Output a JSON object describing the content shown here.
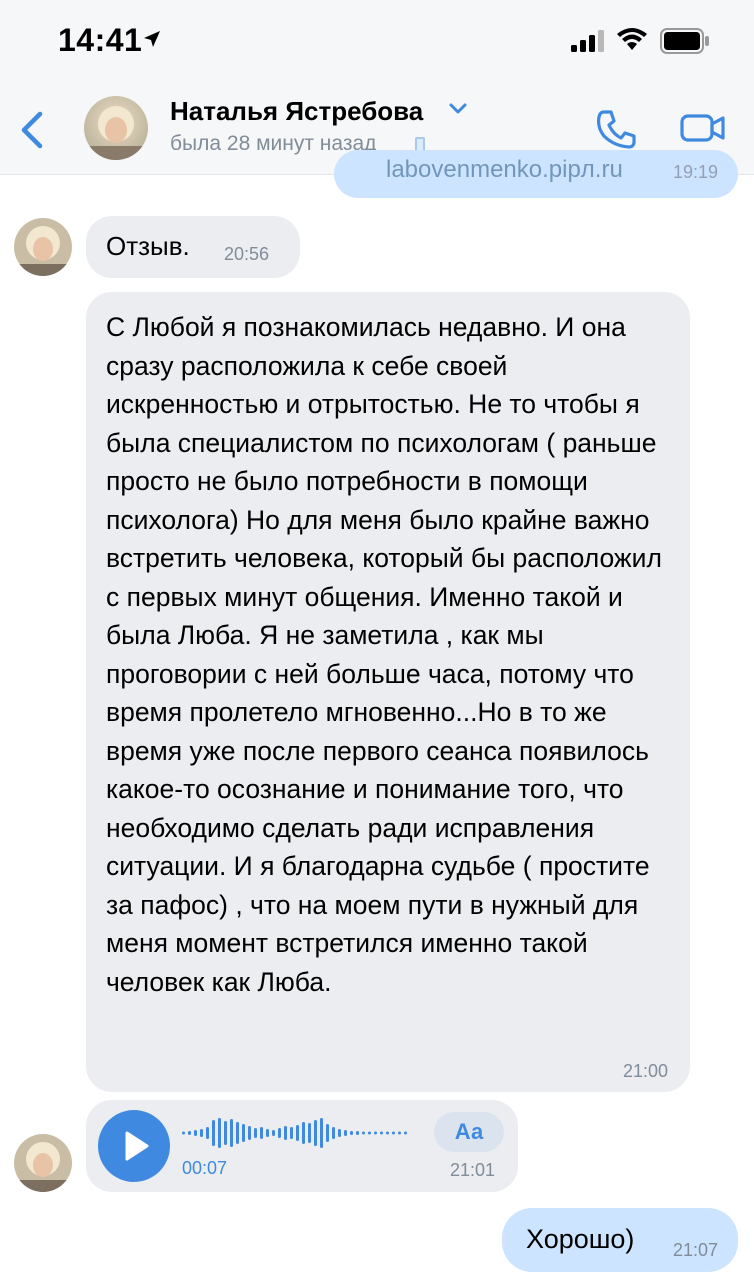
{
  "status_bar": {
    "time": "14:41"
  },
  "header": {
    "contact_name": "Наталья Ястребова",
    "last_seen": "была 28 минут назад"
  },
  "previous_message": {
    "partial_text": "labovenmenko.pipл.ru",
    "time": "19:19"
  },
  "messages": {
    "m1": {
      "text": "Отзыв.",
      "time": "20:56"
    },
    "m2": {
      "text": "С Любой я познакомилась недавно. И она сразу расположила к себе своей искренностью и отрытостью. Не то чтобы я была специалистом по психологам ( раньше просто не было потребности в помощи психолога) Но для меня было крайне важно встретить человека, который бы расположил с первых минут общения. Именно такой и была Люба. Я не заметила , как мы проговории с ней больше часа, потому что время пролетело мгновенно...Но в то же время уже после первого сеанса появилось какое-то осознание и понимание того, что необходимо сделать ради исправления ситуации. И я благодарна судьбе ( простите за пафос) , что на моем пути в нужный для меня момент встретился именно такой человек как Люба.",
      "time": "21:00"
    },
    "voice": {
      "duration": "00:07",
      "transcribe_label": "Аа",
      "time": "21:01"
    },
    "outgoing": {
      "text": "Хорошо)",
      "time": "21:07"
    }
  },
  "colors": {
    "accent": "#3f8ae0",
    "incoming_bubble": "#ebedf0",
    "outgoing_bubble": "#cce4ff",
    "secondary_text": "#818c99"
  },
  "icons": [
    "location-arrow-icon",
    "signal-icon",
    "wifi-icon",
    "battery-icon",
    "back-chevron-icon",
    "dropdown-caret-icon",
    "mobile-device-icon",
    "phone-call-icon",
    "video-call-icon",
    "play-icon",
    "waveform-icon"
  ]
}
